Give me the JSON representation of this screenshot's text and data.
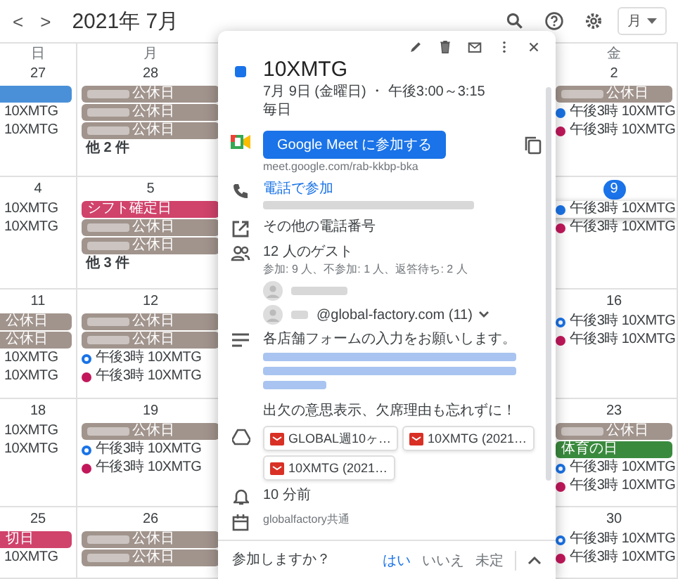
{
  "header": {
    "prev": "<",
    "next": ">",
    "title": "2021年 7月",
    "view": "月"
  },
  "weekdays": [
    "日",
    "月",
    "金"
  ],
  "weeks": [
    {
      "cells": [
        {
          "date": "27",
          "selected": false,
          "items": [
            {
              "kind": "chip",
              "color": "#4a90d9"
            },
            {
              "kind": "event",
              "title": "10XMTG",
              "selected": false
            },
            {
              "kind": "event",
              "title": "10XMTG",
              "selected": false
            }
          ]
        },
        {
          "date": "28",
          "selected": false,
          "items": [
            {
              "kind": "chip",
              "color": "#a1948d",
              "label": "公休日",
              "redacted": true
            },
            {
              "kind": "chip",
              "color": "#a1948d",
              "label": "公休日",
              "redacted": true
            },
            {
              "kind": "chip",
              "color": "#a1948d",
              "label": "公休日",
              "redacted": true
            },
            {
              "kind": "more",
              "label": "他 2 件"
            }
          ]
        },
        {
          "date": "2",
          "selected": false,
          "items": [
            {
              "kind": "chip",
              "color": "#a1948d",
              "label": "公休日",
              "redacted": true
            },
            {
              "kind": "event",
              "time": "午後3時",
              "title": "10XMTG",
              "color": "#1a73e8",
              "hollow": false,
              "selected": false
            },
            {
              "kind": "event",
              "time": "午後3時",
              "title": "10XMTG",
              "color": "#c2185b",
              "hollow": false,
              "selected": false
            }
          ]
        }
      ]
    },
    {
      "cells": [
        {
          "date": "4",
          "selected": false,
          "items": [
            {
              "kind": "event",
              "title": "10XMTG",
              "selected": false
            },
            {
              "kind": "event",
              "title": "10XMTG",
              "selected": false
            }
          ]
        },
        {
          "date": "5",
          "selected": false,
          "items": [
            {
              "kind": "chip",
              "color": "#d0436b",
              "label": "シフト確定日"
            },
            {
              "kind": "chip",
              "color": "#a1948d",
              "label": "公休日",
              "redacted": true
            },
            {
              "kind": "chip",
              "color": "#a1948d",
              "label": "公休日",
              "redacted": true
            },
            {
              "kind": "more",
              "label": "他 3 件"
            }
          ]
        },
        {
          "date": "9",
          "selected": true,
          "items": [
            {
              "kind": "event",
              "time": "午後3時",
              "title": "10XMTG",
              "color": "#1a73e8",
              "hollow": false,
              "selected": true
            },
            {
              "kind": "event",
              "time": "午後3時",
              "title": "10XMTG",
              "color": "#c2185b",
              "hollow": false,
              "selected": false
            }
          ]
        }
      ]
    },
    {
      "cells": [
        {
          "date": "11",
          "selected": false,
          "items": [
            {
              "kind": "chip",
              "color": "#a1948d",
              "label": "公休日"
            },
            {
              "kind": "chip",
              "color": "#a1948d",
              "label": "公休日"
            },
            {
              "kind": "event",
              "title": "10XMTG",
              "selected": false
            },
            {
              "kind": "event",
              "title": "10XMTG",
              "selected": false
            }
          ]
        },
        {
          "date": "12",
          "selected": false,
          "items": [
            {
              "kind": "chip",
              "color": "#a1948d",
              "label": "公休日",
              "redacted": true
            },
            {
              "kind": "chip",
              "color": "#a1948d",
              "label": "公休日",
              "redacted": true
            },
            {
              "kind": "event",
              "time": "午後3時",
              "title": "10XMTG",
              "color": "#1a73e8",
              "hollow": true,
              "selected": false
            },
            {
              "kind": "event",
              "time": "午後3時",
              "title": "10XMTG",
              "color": "#c2185b",
              "hollow": false,
              "selected": false
            }
          ]
        },
        {
          "date": "16",
          "selected": false,
          "items": [
            {
              "kind": "event",
              "time": "午後3時",
              "title": "10XMTG",
              "color": "#1a73e8",
              "hollow": true,
              "selected": false
            },
            {
              "kind": "event",
              "time": "午後3時",
              "title": "10XMTG",
              "color": "#c2185b",
              "hollow": false,
              "selected": false
            }
          ]
        }
      ]
    },
    {
      "cells": [
        {
          "date": "18",
          "selected": false,
          "items": [
            {
              "kind": "event",
              "title": "10XMTG",
              "selected": false
            },
            {
              "kind": "event",
              "title": "10XMTG",
              "selected": false
            }
          ]
        },
        {
          "date": "19",
          "selected": false,
          "items": [
            {
              "kind": "chip",
              "color": "#a1948d",
              "label": "公休日",
              "redacted": true
            },
            {
              "kind": "event",
              "time": "午後3時",
              "title": "10XMTG",
              "color": "#1a73e8",
              "hollow": true,
              "selected": false
            },
            {
              "kind": "event",
              "time": "午後3時",
              "title": "10XMTG",
              "color": "#c2185b",
              "hollow": false,
              "selected": false
            }
          ]
        },
        {
          "date": "23",
          "selected": false,
          "items": [
            {
              "kind": "chip",
              "color": "#a1948d",
              "label": "公休日",
              "redacted": true
            },
            {
              "kind": "chip",
              "color": "#3a8a3e",
              "label": "体育の日"
            },
            {
              "kind": "event",
              "time": "午後3時",
              "title": "10XMTG",
              "color": "#1a73e8",
              "hollow": true,
              "selected": false
            },
            {
              "kind": "event",
              "time": "午後3時",
              "title": "10XMTG",
              "color": "#c2185b",
              "hollow": false,
              "selected": false
            }
          ]
        }
      ]
    },
    {
      "cells": [
        {
          "date": "25",
          "selected": false,
          "items": [
            {
              "kind": "chip",
              "color": "#d0436b",
              "label": "切日"
            },
            {
              "kind": "event",
              "title": "10XMTG",
              "selected": false
            }
          ]
        },
        {
          "date": "26",
          "selected": false,
          "items": [
            {
              "kind": "chip",
              "color": "#a1948d",
              "label": "公休日",
              "redacted": true
            },
            {
              "kind": "chip",
              "color": "#a1948d",
              "label": "公休日",
              "redacted": true
            }
          ]
        },
        {
          "date": "30",
          "selected": false,
          "items": [
            {
              "kind": "event",
              "time": "午後3時",
              "title": "10XMTG",
              "color": "#1a73e8",
              "hollow": true,
              "selected": false
            },
            {
              "kind": "event",
              "time": "午後3時",
              "title": "10XMTG",
              "color": "#c2185b",
              "hollow": false,
              "selected": false
            }
          ]
        }
      ]
    }
  ],
  "popup": {
    "color": "#1a73e8",
    "title": "10XMTG",
    "datetime": "7月 9日 (金曜日) ・ 午後3:00～3:15",
    "recurrence": "毎日",
    "meet": {
      "button": "Google Meet に参加する",
      "url": "meet.google.com/rab-kkbp-bka"
    },
    "phone": {
      "link": "電話で参加",
      "number_redacted": true
    },
    "other_numbers": "その他の電話番号",
    "guests": {
      "title": "12 人のゲスト",
      "summary": "参加: 9 人、不参加: 1 人、返答待ち: 2 人",
      "list": [
        {
          "redacted": true
        },
        {
          "redacted": true,
          "label": "@global-factory.com (11)",
          "expandable": true
        }
      ]
    },
    "description": {
      "text": "各店舗フォームの入力をお願いします。",
      "link_redacted": true,
      "note": "出欠の意思表示、欠席理由も忘れずに！"
    },
    "attachments": [
      {
        "label": "GLOBAL週10ヶ…"
      },
      {
        "label": "10XMTG (2021…"
      },
      {
        "label": "10XMTG (2021…"
      }
    ],
    "reminder": "10 分前",
    "calendar": "globalfactory共通",
    "rsvp": {
      "prompt": "参加しますか？",
      "options": [
        {
          "label": "はい",
          "selected": true
        },
        {
          "label": "いいえ",
          "selected": false
        },
        {
          "label": "未定",
          "selected": false
        }
      ]
    }
  }
}
